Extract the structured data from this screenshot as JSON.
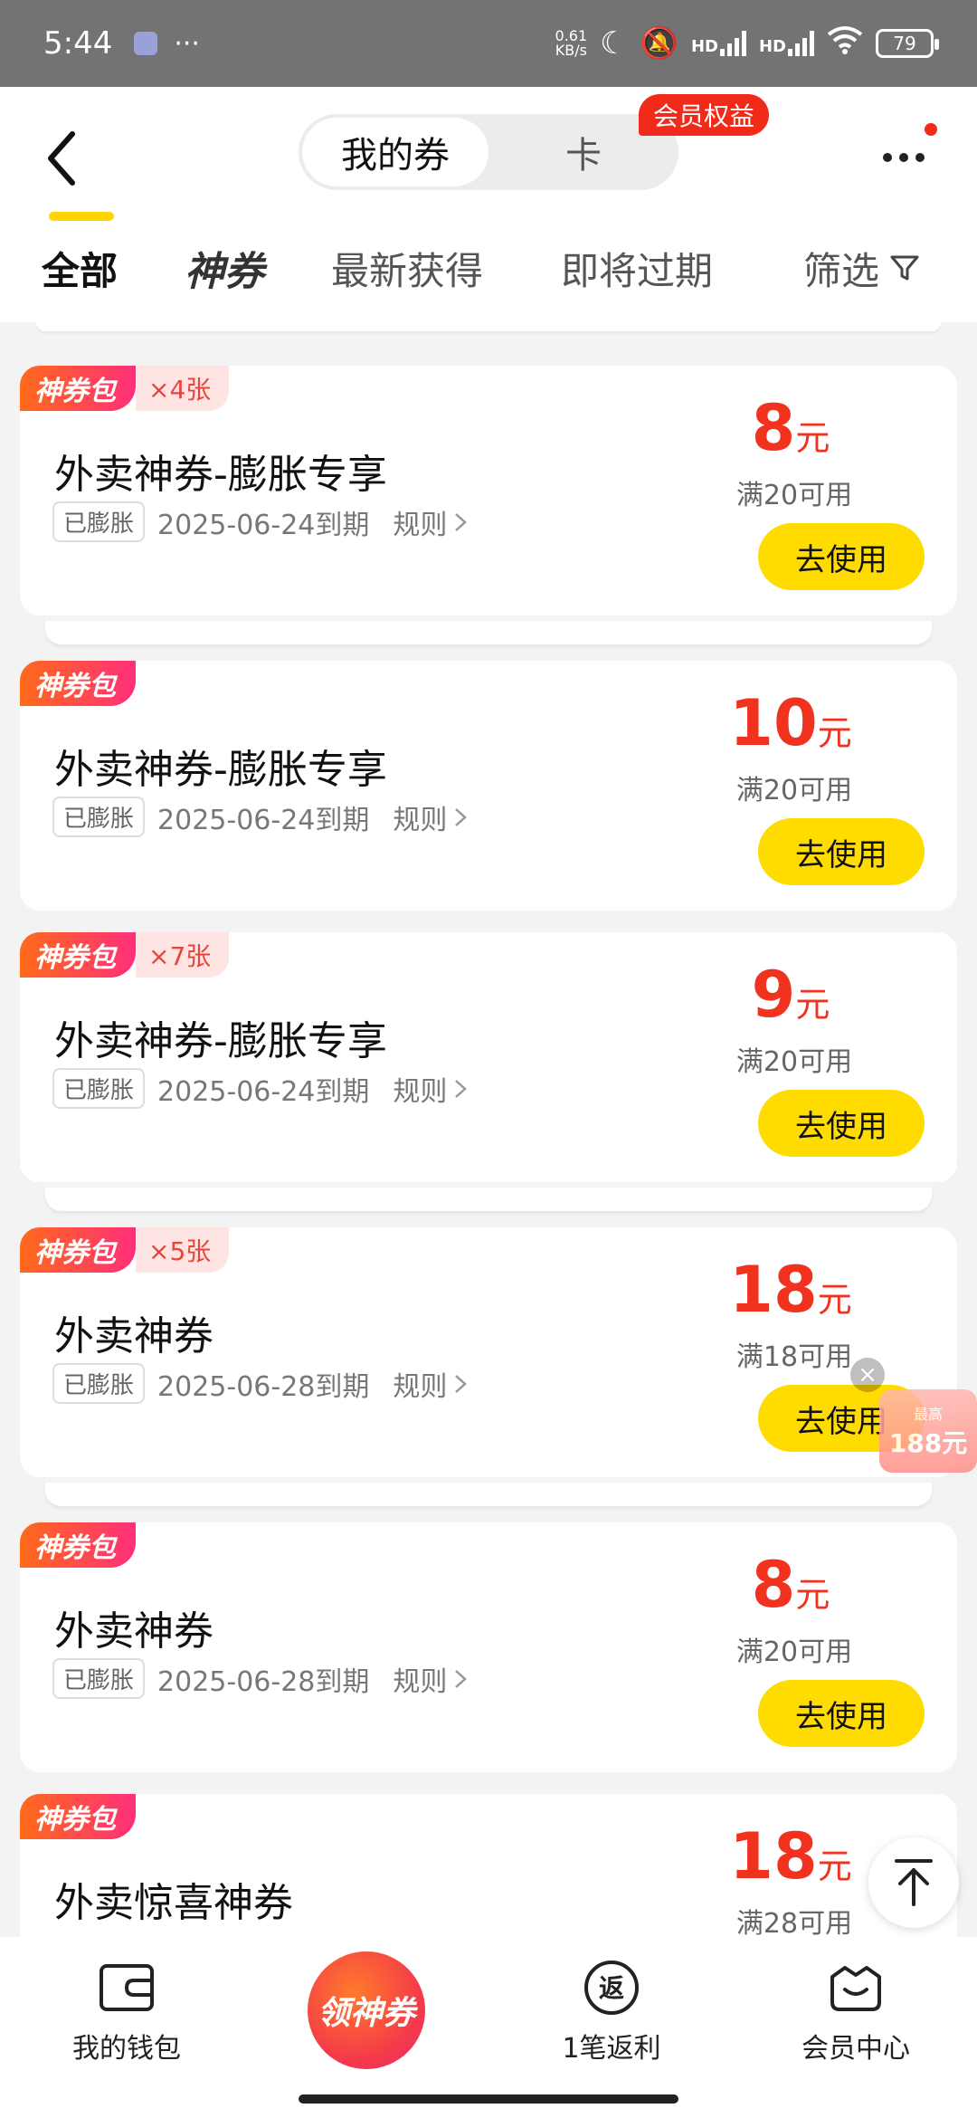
{
  "status_bar": {
    "time": "5:44",
    "extra": "···",
    "net_speed_value": "0.61",
    "net_speed_unit": "KB/s",
    "signal1": "HD",
    "signal2": "HD",
    "battery": "79"
  },
  "header": {
    "segments": [
      "我的券",
      "卡"
    ],
    "vip_badge": "会员权益",
    "tabs": {
      "all": "全部",
      "brand": "神券",
      "latest": "最新获得",
      "expiring": "即将过期",
      "filter": "筛选"
    }
  },
  "cards": [
    {
      "pack": "神券包",
      "count": "×4张",
      "title": "外卖神券-膨胀专享",
      "tag": "已膨胀",
      "expiry": "2025-06-24到期",
      "rule": "规则",
      "amount": "8",
      "unit": "元",
      "threshold": "满20可用",
      "action": "去使用"
    },
    {
      "pack": "神券包",
      "count": "",
      "title": "外卖神券-膨胀专享",
      "tag": "已膨胀",
      "expiry": "2025-06-24到期",
      "rule": "规则",
      "amount": "10",
      "unit": "元",
      "threshold": "满20可用",
      "action": "去使用"
    },
    {
      "pack": "神券包",
      "count": "×7张",
      "title": "外卖神券-膨胀专享",
      "tag": "已膨胀",
      "expiry": "2025-06-24到期",
      "rule": "规则",
      "amount": "9",
      "unit": "元",
      "threshold": "满20可用",
      "action": "去使用"
    },
    {
      "pack": "神券包",
      "count": "×5张",
      "title": "外卖神券",
      "tag": "已膨胀",
      "expiry": "2025-06-28到期",
      "rule": "规则",
      "amount": "18",
      "unit": "元",
      "threshold": "满18可用",
      "action": "去使用"
    },
    {
      "pack": "神券包",
      "count": "",
      "title": "外卖神券",
      "tag": "已膨胀",
      "expiry": "2025-06-28到期",
      "rule": "规则",
      "amount": "8",
      "unit": "元",
      "threshold": "满20可用",
      "action": "去使用"
    },
    {
      "pack": "神券包",
      "count": "",
      "title": "外卖惊喜神券",
      "tag": "",
      "expiry": "",
      "rule": "",
      "amount": "18",
      "unit": "元",
      "threshold": "满28可用",
      "action": ""
    }
  ],
  "float_promo": {
    "line1": "最高",
    "line2": "188元"
  },
  "bottom_nav": {
    "wallet": "我的钱包",
    "center": "领神券",
    "rebate": "1笔返利",
    "rebate_icon_char": "返",
    "member": "会员中心"
  },
  "colors": {
    "accent_yellow": "#ffdc00",
    "price_red": "#f0321e",
    "badge_red": "#f22a1a"
  }
}
